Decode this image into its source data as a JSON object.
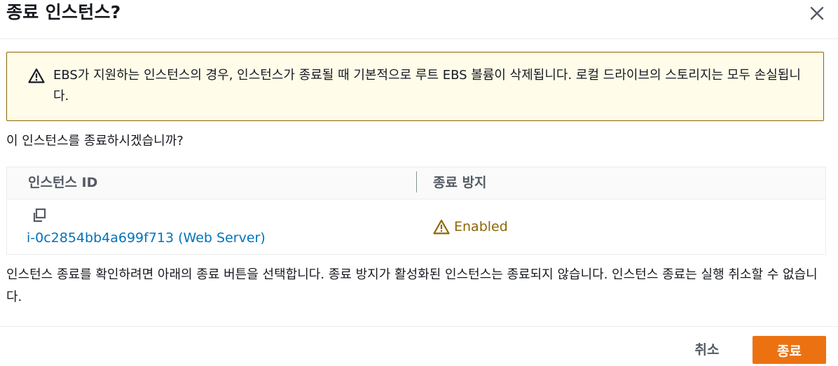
{
  "dialog": {
    "title": "종료 인스턴스?",
    "close_icon": "close-icon"
  },
  "warning": {
    "icon": "warning-icon",
    "text": "EBS가 지원하는 인스턴스의 경우, 인스턴스가 종료될 때 기본적으로 루트 EBS 볼륨이 삭제됩니다. 로컬 드라이브의 스토리지는 모두 손실됩니다."
  },
  "question": "이 인스턴스를 종료하시겠습니까?",
  "table": {
    "columns": [
      "인스턴스 ID",
      "종료 방지"
    ],
    "rows": [
      {
        "copy_icon": "copy-icon",
        "instance": "i-0c2854bb4a699f713 (Web Server)",
        "protection_icon": "warning-icon",
        "protection": "Enabled"
      }
    ]
  },
  "confirm_text": "인스턴스 종료를 확인하려면 아래의 종료 버튼을 선택합니다. 종료 방지가 활성화된 인스턴스는 종료되지 않습니다. 인스턴스 종료는 실행 취소할 수 없습니다.",
  "footer": {
    "cancel_label": "취소",
    "terminate_label": "종료"
  },
  "colors": {
    "warning_bg": "#fffce9",
    "warning_border": "#8d6605",
    "link": "#0073bb",
    "primary_button": "#ec7211"
  }
}
